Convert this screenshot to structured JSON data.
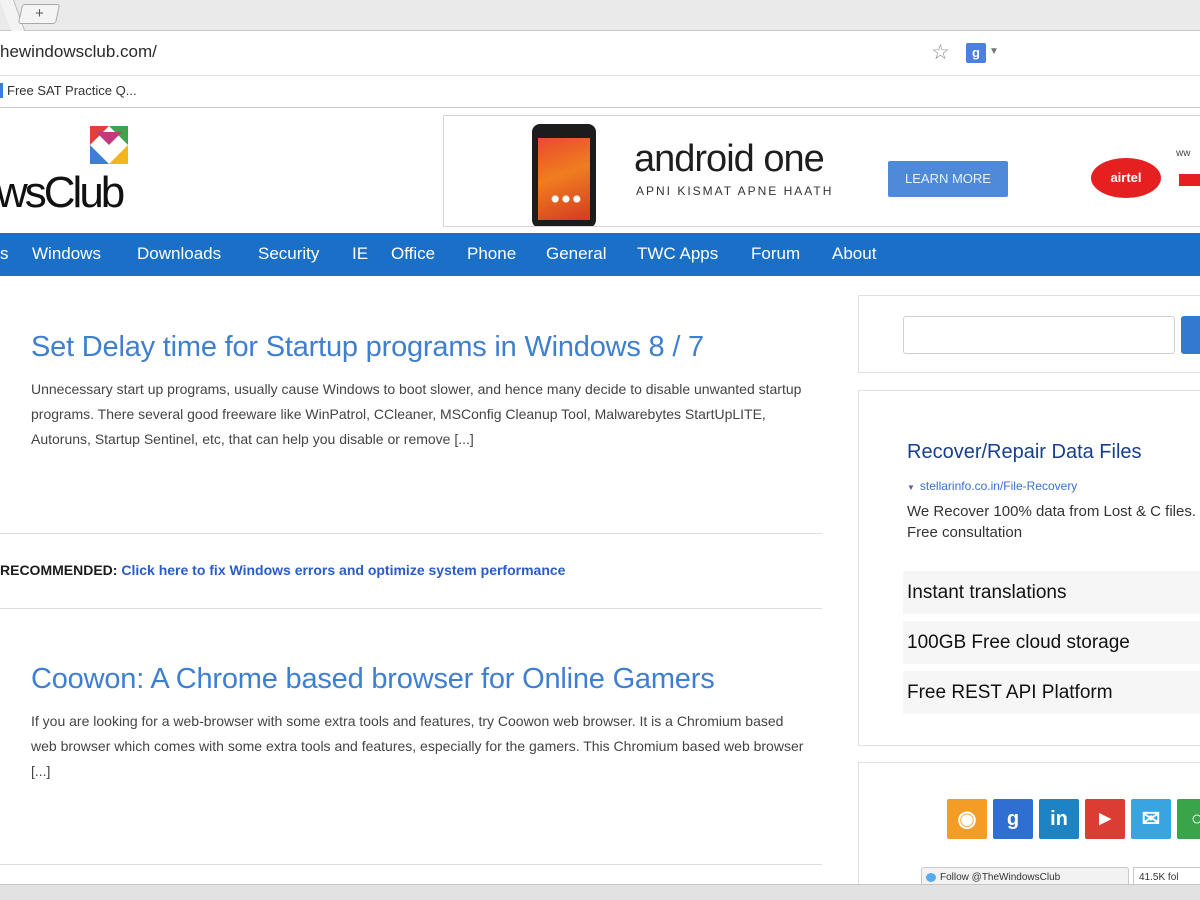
{
  "browser": {
    "url": "hewindowsclub.com/",
    "new_tab_label": "+",
    "bookmark": "Free SAT Practice Q..."
  },
  "site": {
    "logo_text": "wsClub"
  },
  "ad_banner": {
    "brand": "android one",
    "tagline": "APNI KISMAT APNE HAATH",
    "button": "LEARN MORE",
    "partner": "airtel",
    "partner_fragment": "ww"
  },
  "nav": {
    "items": [
      "s",
      "Windows",
      "Downloads",
      "Security",
      "IE",
      "Office",
      "Phone",
      "General",
      "TWC Apps",
      "Forum",
      "About"
    ]
  },
  "articles": [
    {
      "title": "Set Delay time for Startup programs in Windows 8 / 7",
      "excerpt": "Unnecessary start up programs, usually cause Windows to boot slower, and hence many decide to disable unwanted startup programs. There several good freeware like WinPatrol, CCleaner, MSConfig Cleanup Tool, Malwarebytes StartUpLITE, Autoruns, Startup Sentinel, etc, that can help you disable or remove [...]"
    },
    {
      "title": "Coowon: A Chrome based browser for Online Gamers",
      "excerpt": "If you are looking for a web-browser with some extra tools and features, try Coowon web browser. It is a Chromium based web browser which comes with some extra tools and features, especially for the gamers. This Chromium based web browser [...]"
    }
  ],
  "recommended": {
    "label": "RECOMMENDED:",
    "link": "Click here to fix Windows errors and optimize system performance"
  },
  "sidebar": {
    "search_value": "",
    "ad": {
      "title": "Recover/Repair Data Files",
      "url": "stellarinfo.co.in/File-Recovery",
      "description": "We Recover 100% data from Lost & C files. Free consultation"
    },
    "ad_links": [
      "Instant translations",
      "100GB Free cloud storage",
      "Free REST API Platform"
    ],
    "social": [
      "rss-icon",
      "google-plus-icon",
      "linkedin-icon",
      "youtube-icon",
      "email-icon",
      "other-icon"
    ],
    "follow_label": "Follow @TheWindowsClub",
    "follow_count": "41.5K fol"
  },
  "colors": {
    "nav_bg": "#1a6fc7",
    "article_title": "#3f7fcf",
    "recommended_link": "#2a5bc8",
    "sidebar_ad_title": "#173f8a"
  }
}
